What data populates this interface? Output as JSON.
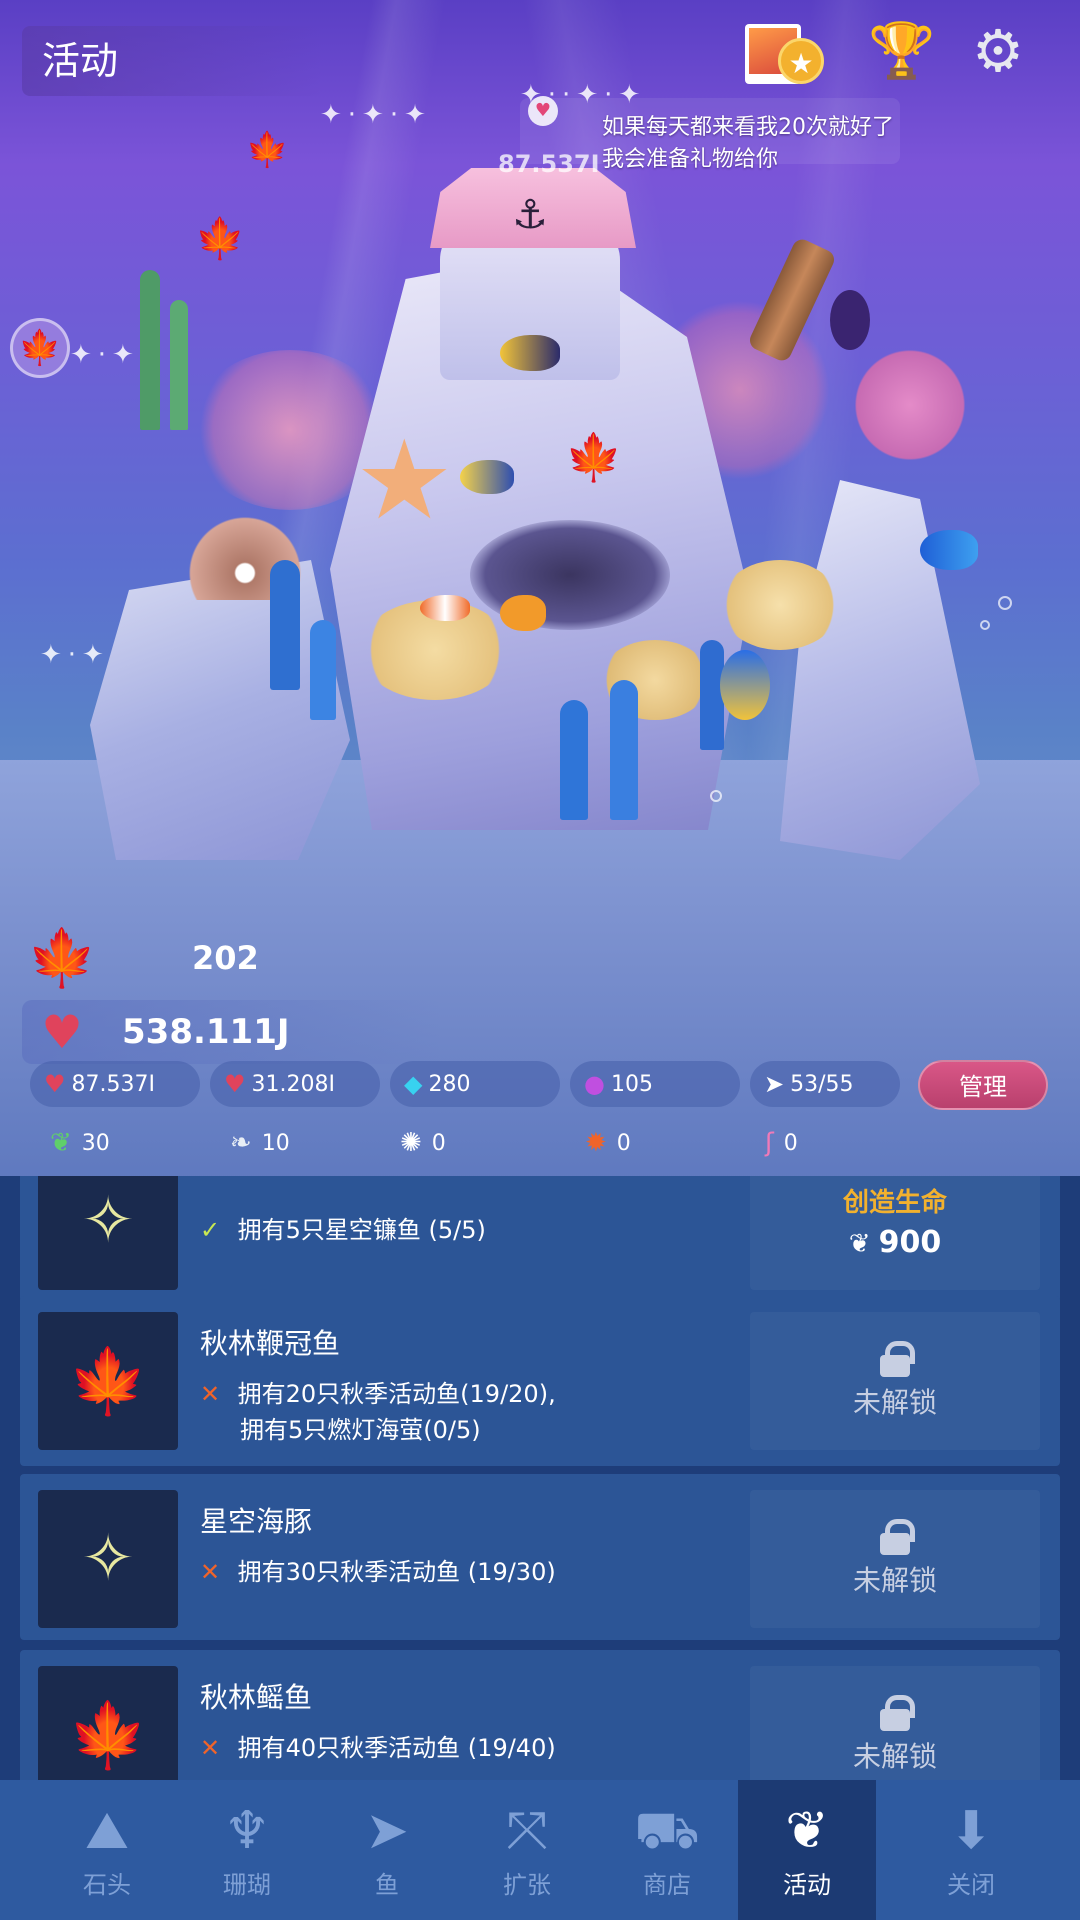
{
  "header": {
    "title": "活动",
    "speech_line1": "如果每天都来看我20次就好了",
    "speech_line2": "我会准备礼物给你",
    "rate_label": "87.537I"
  },
  "icons": {
    "photo": "photo-album-icon",
    "medal": "medal-icon",
    "trophy": "trophy-icon",
    "settings": "gear-icon",
    "leaf": "maple-leaf-icon",
    "heart": "heart-icon"
  },
  "stats": {
    "leaves": "202",
    "hearts": "538.111J",
    "rate_per_tap": "87.537I",
    "rate_timed": "31.208I",
    "gems": "280",
    "pearls": "105",
    "fish_count": "53/55",
    "manage_label": "管理"
  },
  "resources": [
    {
      "icon": "seaweed-icon",
      "value": "30"
    },
    {
      "icon": "shell-icon",
      "value": "10"
    },
    {
      "icon": "urchin-icon",
      "value": "0"
    },
    {
      "icon": "crab-icon",
      "value": "0"
    },
    {
      "icon": "flamingo-icon",
      "value": "0"
    }
  ],
  "list": {
    "items": [
      {
        "name": "",
        "req1_mark": "✓",
        "req1": "拥有5只星空镰鱼 (5/5)",
        "action_title": "创造生命",
        "price": "900"
      },
      {
        "name": "秋林鞭冠鱼",
        "req1_mark": "✕",
        "req1": "拥有20只秋季活动鱼(19/20),",
        "req2": "拥有5只燃灯海萤(0/5)",
        "action": "未解锁"
      },
      {
        "name": "星空海豚",
        "req1_mark": "✕",
        "req1": "拥有30只秋季活动鱼 (19/30)",
        "action": "未解锁"
      },
      {
        "name": "秋林鳐鱼",
        "req1_mark": "✕",
        "req1": "拥有40只秋季活动鱼 (19/40)",
        "action": "未解锁"
      }
    ]
  },
  "nav": {
    "items": [
      {
        "label": "石头",
        "icon": "rock-icon"
      },
      {
        "label": "珊瑚",
        "icon": "coral-icon"
      },
      {
        "label": "鱼",
        "icon": "fish-icon"
      },
      {
        "label": "扩张",
        "icon": "expand-icon"
      },
      {
        "label": "商店",
        "icon": "cart-icon"
      },
      {
        "label": "活动",
        "icon": "maple-leaf-icon"
      },
      {
        "label": "关闭",
        "icon": "close-down-icon"
      }
    ],
    "active": "活动"
  },
  "colors": {
    "accent_orange": "#f06a2c",
    "manage_pink": "#c84a78",
    "nav_bg": "#2e5aa0",
    "list_bg": "#1e3d79",
    "gold": "#f2b12e"
  }
}
